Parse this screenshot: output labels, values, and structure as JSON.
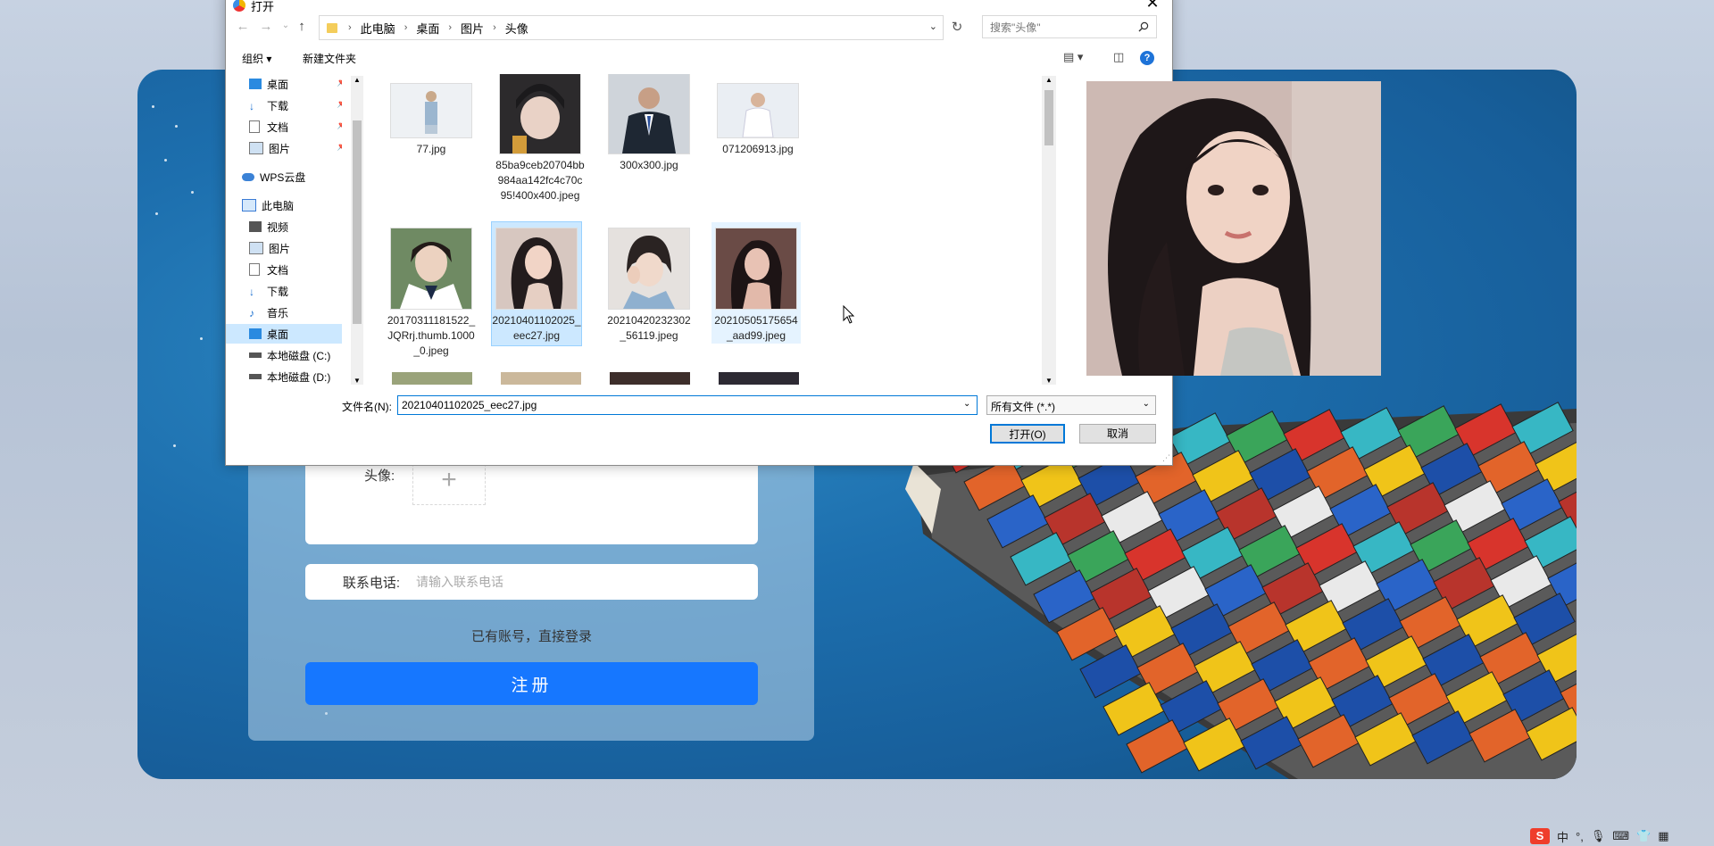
{
  "dialog": {
    "title": "打开",
    "close": "✕",
    "nav": {
      "back": "←",
      "forward": "→",
      "recent": "⌄",
      "up": "↑"
    },
    "breadcrumb": [
      "此电脑",
      "桌面",
      "图片",
      "头像"
    ],
    "refresh": "↻",
    "search_placeholder": "搜索\"头像\"",
    "organize": "组织 ▾",
    "new_folder": "新建文件夹",
    "help": "?",
    "nav_pane": [
      {
        "label": "桌面",
        "pinned": true
      },
      {
        "label": "下载",
        "pinned": true
      },
      {
        "label": "文档",
        "pinned": true
      },
      {
        "label": "图片",
        "pinned": true
      },
      {
        "label": "WPS云盘"
      },
      {
        "label": "此电脑"
      },
      {
        "label": "视频"
      },
      {
        "label": "图片"
      },
      {
        "label": "文档"
      },
      {
        "label": "下载"
      },
      {
        "label": "音乐"
      },
      {
        "label": "桌面",
        "selected": true
      },
      {
        "label": "本地磁盘 (C:)"
      },
      {
        "label": "本地磁盘 (D:)"
      }
    ],
    "files": [
      {
        "name": "77.jpg"
      },
      {
        "name": "85ba9ceb20704bb984aa142fc4c70c95!400x400.jpeg"
      },
      {
        "name": "300x300.jpg"
      },
      {
        "name": "071206913.jpg"
      },
      {
        "name": "20170311181522_JQRrj.thumb.1000_0.jpeg"
      },
      {
        "name": "20210401102025_eec27.jpg",
        "selected": true
      },
      {
        "name": "20210420232302_56119.jpeg"
      },
      {
        "name": "20210505175654_aad99.jpeg"
      }
    ],
    "file_name_label": "文件名(N):",
    "file_name_value": "20210401102025_eec27.jpg",
    "file_type": "所有文件 (*.*)",
    "open_button": "打开(O)",
    "cancel_button": "取消"
  },
  "form": {
    "avatar_label": "头像:",
    "upload_plus": "+",
    "phone_label": "联系电话:",
    "phone_placeholder": "请输入联系电话",
    "login_link": "已有账号，直接登录",
    "register_button": "注册"
  },
  "tray": {
    "ime": "S",
    "lang": "中",
    "punct": "°,"
  }
}
